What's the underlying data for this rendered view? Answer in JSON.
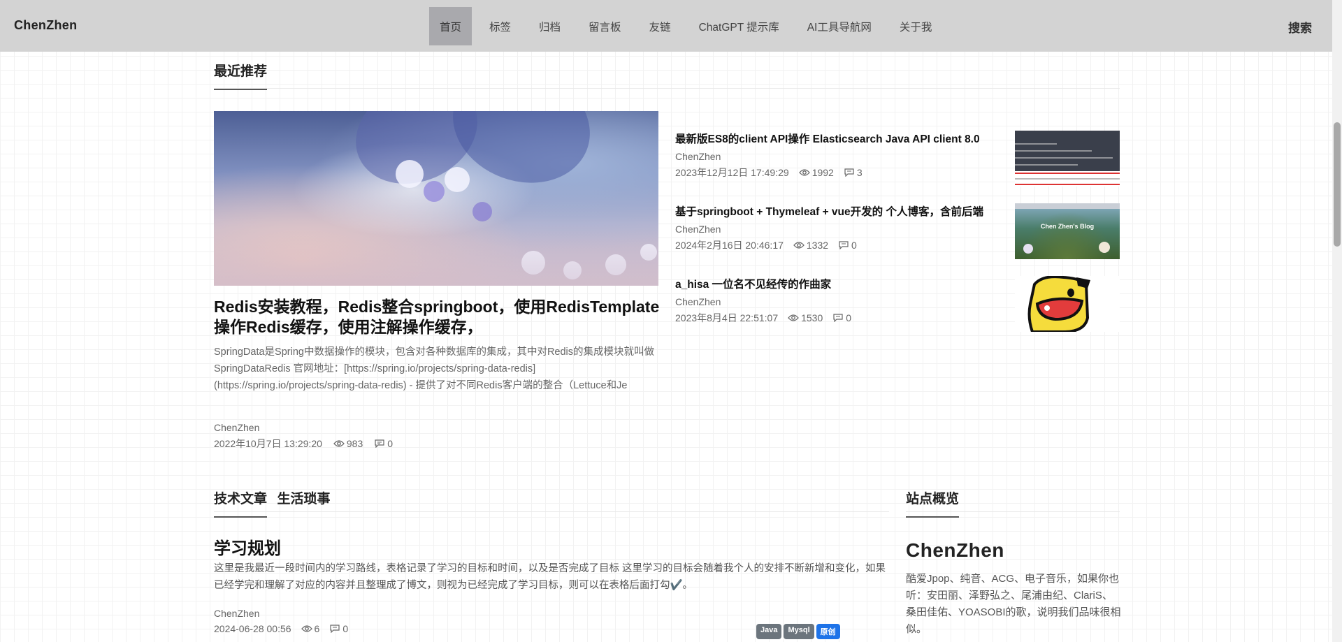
{
  "header": {
    "brand": "ChenZhen",
    "nav": [
      "首页",
      "标签",
      "归档",
      "留言板",
      "友链",
      "ChatGPT 提示库",
      "AI工具导航网",
      "关于我"
    ],
    "active_index": 0,
    "search": "搜索"
  },
  "recommend": {
    "section_title": "最近推荐",
    "featured": {
      "title": "Redis安装教程，Redis整合springboot，使用RedisTemplate操作Redis缓存，使用注解操作缓存，",
      "desc": "SpringData是Spring中数据操作的模块，包含对各种数据库的集成，其中对Redis的集成模块就叫做SpringDataRedis 官网地址：[https://spring.io/projects/spring-data-redis](https://spring.io/projects/spring-data-redis) - 提供了对不同Redis客户端的整合（Lettuce和Je",
      "author": "ChenZhen",
      "date": "2022年10月7日 13:29:20",
      "views": "983",
      "comments": "0"
    },
    "side": [
      {
        "title": "最新版ES8的client API操作 Elasticsearch Java API client 8.0",
        "author": "ChenZhen",
        "date": "2023年12月12日 17:49:29",
        "views": "1992",
        "comments": "3"
      },
      {
        "title": "基于springboot + Thymeleaf + vue开发的 个人博客，含前后端",
        "author": "ChenZhen",
        "date": "2024年2月16日 20:46:17",
        "views": "1332",
        "comments": "0"
      },
      {
        "title": "a_hisa 一位名不见经传的作曲家",
        "author": "ChenZhen",
        "date": "2023年8月4日 22:51:07",
        "views": "1530",
        "comments": "0"
      }
    ]
  },
  "posts": {
    "tabs": [
      "技术文章",
      "生活琐事"
    ],
    "items": [
      {
        "title": "学习规划",
        "desc": "这里是我最近一段时间内的学习路线，表格记录了学习的目标和时间，以及是否完成了目标 这里学习的目标会随着我个人的安排不断新增和变化，如果已经学完和理解了对应的内容并且整理成了博文，则视为已经完成了学习目标，则可以在表格后面打勾✔️。",
        "author": "ChenZhen",
        "date": "2024-06-28 00:56",
        "views": "6",
        "comments": "0",
        "tags": [
          {
            "label": "Java",
            "color": "#6c757d"
          },
          {
            "label": "Mysql",
            "color": "#6c757d"
          },
          {
            "label": "原创",
            "color": "#1e73e8"
          }
        ]
      }
    ]
  },
  "overview": {
    "section_title": "站点概览",
    "name": "ChenZhen",
    "desc": "酷爱Jpop、纯音、ACG、电子音乐，如果你也听：安田丽、泽野弘之、尾浦由纪、ClariS、桑田佳佑、YOASOBI的歌，说明我们品味很相似。"
  },
  "thumb_text": {
    "blog_banner": "Chen Zhen's Blog"
  }
}
